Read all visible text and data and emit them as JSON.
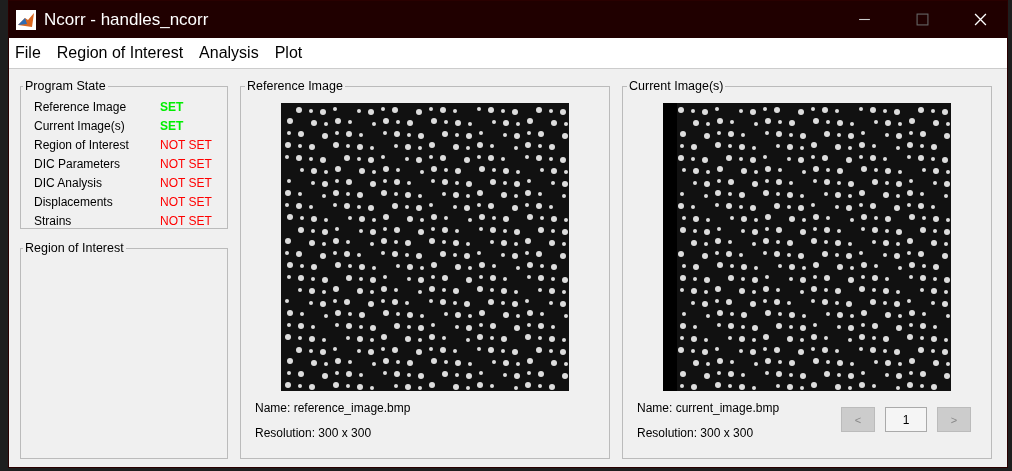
{
  "window": {
    "title": "Ncorr - handles_ncorr"
  },
  "menu": [
    "File",
    "Region of Interest",
    "Analysis",
    "Plot"
  ],
  "program_state": {
    "title": "Program State",
    "items": [
      {
        "label": "Reference Image",
        "status": "SET",
        "set": true
      },
      {
        "label": "Current Image(s)",
        "status": "SET",
        "set": true
      },
      {
        "label": "Region of Interest",
        "status": "NOT SET",
        "set": false
      },
      {
        "label": "DIC Parameters",
        "status": "NOT SET",
        "set": false
      },
      {
        "label": "DIC Analysis",
        "status": "NOT SET",
        "set": false
      },
      {
        "label": "Displacements",
        "status": "NOT SET",
        "set": false
      },
      {
        "label": "Strains",
        "status": "NOT SET",
        "set": false
      }
    ]
  },
  "region_of_interest": {
    "title": "Region of Interest"
  },
  "panels": [
    {
      "title": "Reference Image",
      "name": "Name: reference_image.bmp",
      "resolution": "Resolution: 300 x 300"
    },
    {
      "title": "Current Image(s)",
      "name": "Name: current_image.bmp",
      "resolution": "Resolution: 300 x 300",
      "pager": {
        "prev": {
          "label": "<",
          "disabled": true
        },
        "page": "1",
        "next": {
          "label": ">",
          "disabled": true
        }
      }
    }
  ]
}
